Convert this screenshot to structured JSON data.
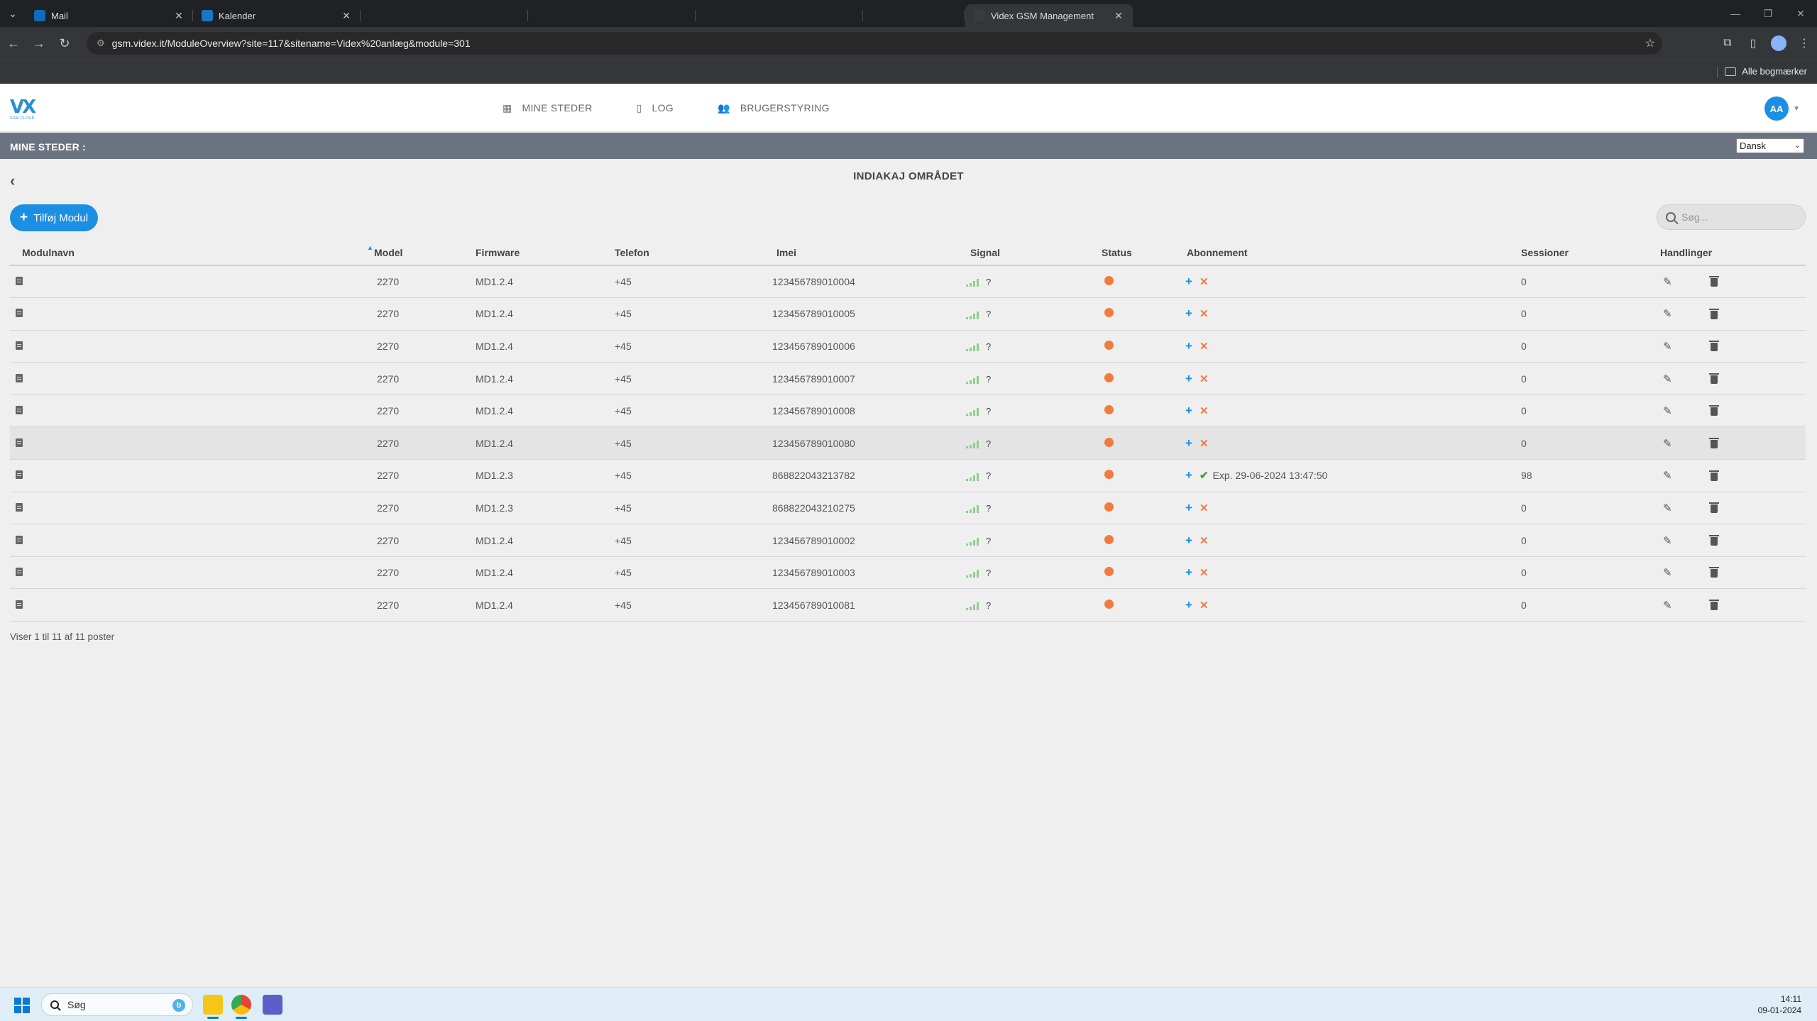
{
  "browser": {
    "tabs": [
      {
        "title": "Mail",
        "active": false
      },
      {
        "title": "Kalender",
        "active": false
      },
      {
        "title": "Videx GSM Management",
        "active": true
      }
    ],
    "url": "gsm.videx.it/ModuleOverview?site=117&sitename=Videx%20anlæg&module=301",
    "bookmarks_label": "Alle bogmærker"
  },
  "app": {
    "logo_text": "VX",
    "logo_sub": "GSM CLOUD",
    "nav": [
      {
        "label": "MINE STEDER",
        "icon": "building-icon"
      },
      {
        "label": "LOG",
        "icon": "clipboard-icon"
      },
      {
        "label": "BRUGERSTYRING",
        "icon": "users-icon"
      }
    ],
    "avatar_initials": "AA",
    "breadcrumb": "MINE STEDER :",
    "language": "Dansk",
    "page_title": "INDIAKAJ OMRÅDET",
    "add_button": "Tilføj Modul",
    "search_placeholder": "Søg...",
    "footer_info": "Viser 1 til 11 af 11 poster"
  },
  "table": {
    "columns": [
      "Modulnavn",
      "Model",
      "Firmware",
      "Telefon",
      "Imei",
      "Signal",
      "Status",
      "Abonnement",
      "Sessioner",
      "Handlinger"
    ],
    "signal_unknown": "?",
    "rows": [
      {
        "model": "2270",
        "firmware": "MD1.2.4",
        "telefon": "+45",
        "imei": "123456789010004",
        "subscription": "",
        "sessions": "0"
      },
      {
        "model": "2270",
        "firmware": "MD1.2.4",
        "telefon": "+45",
        "imei": "123456789010005",
        "subscription": "",
        "sessions": "0"
      },
      {
        "model": "2270",
        "firmware": "MD1.2.4",
        "telefon": "+45",
        "imei": "123456789010006",
        "subscription": "",
        "sessions": "0"
      },
      {
        "model": "2270",
        "firmware": "MD1.2.4",
        "telefon": "+45",
        "imei": "123456789010007",
        "subscription": "",
        "sessions": "0"
      },
      {
        "model": "2270",
        "firmware": "MD1.2.4",
        "telefon": "+45",
        "imei": "123456789010008",
        "subscription": "",
        "sessions": "0"
      },
      {
        "model": "2270",
        "firmware": "MD1.2.4",
        "telefon": "+45",
        "imei": "123456789010080",
        "subscription": "",
        "sessions": "0",
        "highlighted": true
      },
      {
        "model": "2270",
        "firmware": "MD1.2.3",
        "telefon": "+45",
        "imei": "868822043213782",
        "subscription": "Exp. 29-06-2024 13:47:50",
        "sessions": "98"
      },
      {
        "model": "2270",
        "firmware": "MD1.2.3",
        "telefon": "+45",
        "imei": "868822043210275",
        "subscription": "",
        "sessions": "0"
      },
      {
        "model": "2270",
        "firmware": "MD1.2.4",
        "telefon": "+45",
        "imei": "123456789010002",
        "subscription": "",
        "sessions": "0"
      },
      {
        "model": "2270",
        "firmware": "MD1.2.4",
        "telefon": "+45",
        "imei": "123456789010003",
        "subscription": "",
        "sessions": "0"
      },
      {
        "model": "2270",
        "firmware": "MD1.2.4",
        "telefon": "+45",
        "imei": "123456789010081",
        "subscription": "",
        "sessions": "0"
      }
    ]
  },
  "taskbar": {
    "search_label": "Søg",
    "time": "14:11",
    "date": "09-01-2024"
  },
  "colors": {
    "accent": "#1a8fe3",
    "status_dot": "#f07b3f",
    "active_check": "#2eaa3a",
    "breadcrumb_bar": "#6b7280"
  }
}
